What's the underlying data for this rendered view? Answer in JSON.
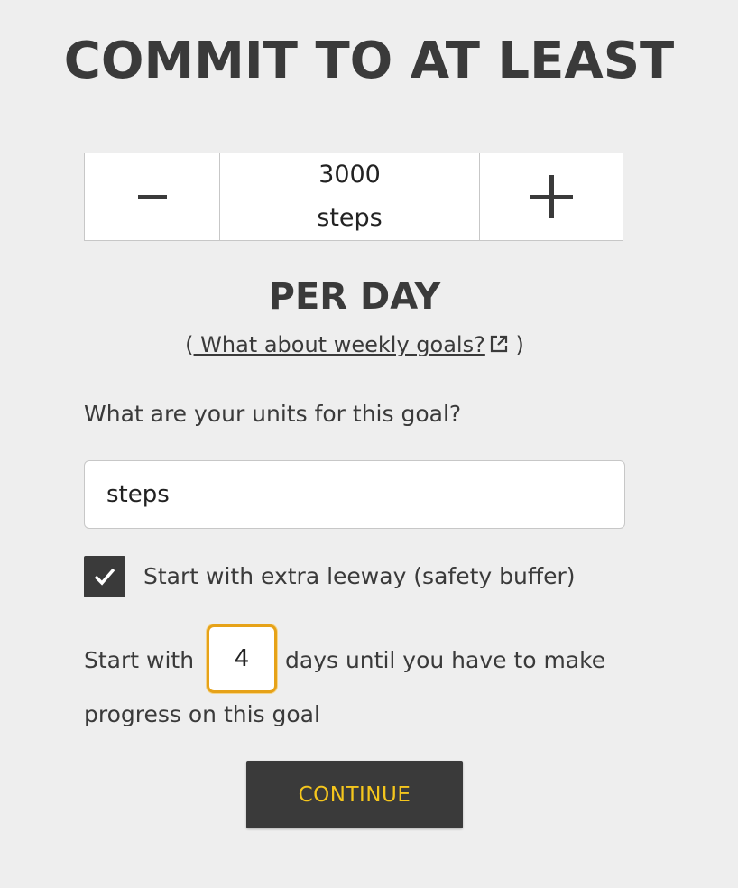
{
  "header": {
    "title": "COMMIT TO AT LEAST"
  },
  "stepper": {
    "value": "3000",
    "unit": "steps",
    "minus_icon": "minus-icon",
    "plus_icon": "plus-icon"
  },
  "rate": {
    "per_label": "PER DAY",
    "weekly_link_open": "(",
    "weekly_link_label": " What about weekly goals?",
    "weekly_link_close": ")",
    "weekly_link_icon": "external-link-icon"
  },
  "units": {
    "question": "What are your units for this goal?",
    "value": "steps"
  },
  "leeway": {
    "checked": true,
    "checkbox_label": "Start with extra leeway (safety buffer)",
    "prefix": "Start with",
    "days_value": "4",
    "suffix": "days until you have to make",
    "suffix_line2": "progress on this goal"
  },
  "actions": {
    "continue_label": "CONTINUE"
  },
  "colors": {
    "background": "#eeeeee",
    "text": "#3a3a3a",
    "button_bg": "#3a3a3a",
    "button_text": "#f5c61d",
    "focus_border": "#e6a218"
  }
}
